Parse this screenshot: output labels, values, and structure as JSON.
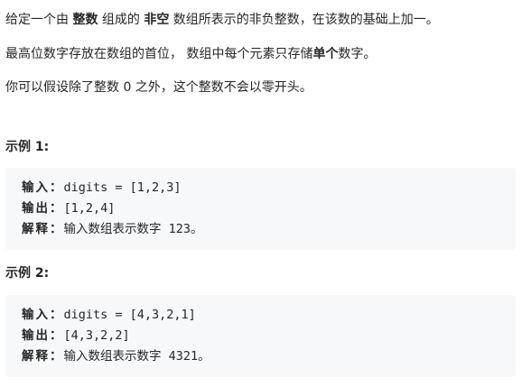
{
  "problem": {
    "p1": {
      "t1": "给定一个由 ",
      "b1": "整数",
      "t2": " 组成的 ",
      "b2": "非空",
      "t3": " 数组所表示的非负整数，在该数的基础上加一。"
    },
    "p2": {
      "t1": "最高位数字存放在数组的首位， 数组中每个元素只存储",
      "b1": "单个",
      "t2": "数字。"
    },
    "p3": "你可以假设除了整数 0 之外，这个整数不会以零开头。"
  },
  "labels": {
    "input": "输入：",
    "output": "输出：",
    "explanation": "解释："
  },
  "examples": [
    {
      "title": "示例 1:",
      "input": "digits = [1,2,3]",
      "output": "[1,2,4]",
      "explanation": "输入数组表示数字 123。"
    },
    {
      "title": "示例 2:",
      "input": "digits = [4,3,2,1]",
      "output": "[4,3,2,2]",
      "explanation": "输入数组表示数字 4321。"
    }
  ]
}
